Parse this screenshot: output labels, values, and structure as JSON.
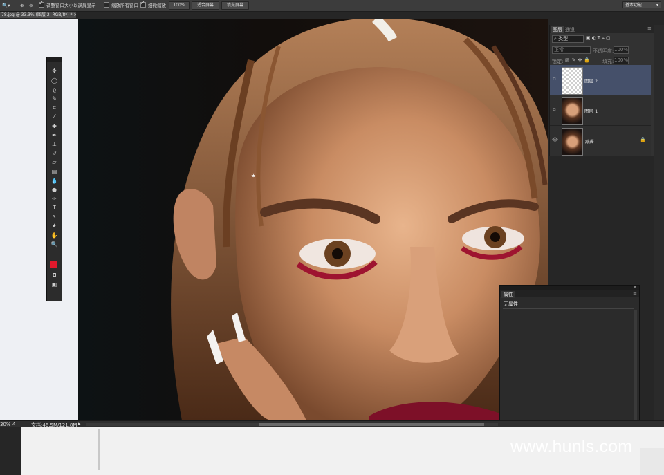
{
  "options_bar": {
    "zoom_tool_icon": "zoom-icon",
    "resize_windows_label": "调整窗口大小以满屏显示",
    "resize_windows_checked": true,
    "zoom_all_windows_label": "缩放所有窗口",
    "zoom_all_windows_checked": false,
    "scrubby_zoom_label": "细微缩放",
    "scrubby_zoom_checked": true,
    "btn_100": "100%",
    "btn_fit_screen": "适合屏幕",
    "btn_fill_screen": "填充屏幕",
    "workspace": "基本功能"
  },
  "document": {
    "tab_title": "78.jpg @ 33.3% (图层 2, RGB/8*) *"
  },
  "status_bar": {
    "zoom": "30%",
    "doc_size": "文档:46.5M/121.8M"
  },
  "layers_panel": {
    "tab_layers": "图层",
    "tab_channels": "通道",
    "filter_kind": "类型",
    "blend_mode": "正常",
    "opacity_label": "不透明度:",
    "opacity_value": "100%",
    "lock_label": "锁定:",
    "fill_label": "填充:",
    "fill_value": "100%",
    "layers": [
      {
        "name": "图层 2",
        "selected": true,
        "visible": false
      },
      {
        "name": "图层 1",
        "selected": false,
        "visible": false
      },
      {
        "name": "背景",
        "selected": false,
        "visible": true
      }
    ]
  },
  "properties_panel": {
    "tab": "属性",
    "content": "无属性"
  },
  "watermark": "www.hunls.com",
  "colors": {
    "foreground": "#e0192c",
    "background": "#000000",
    "selection": "#45506a"
  }
}
